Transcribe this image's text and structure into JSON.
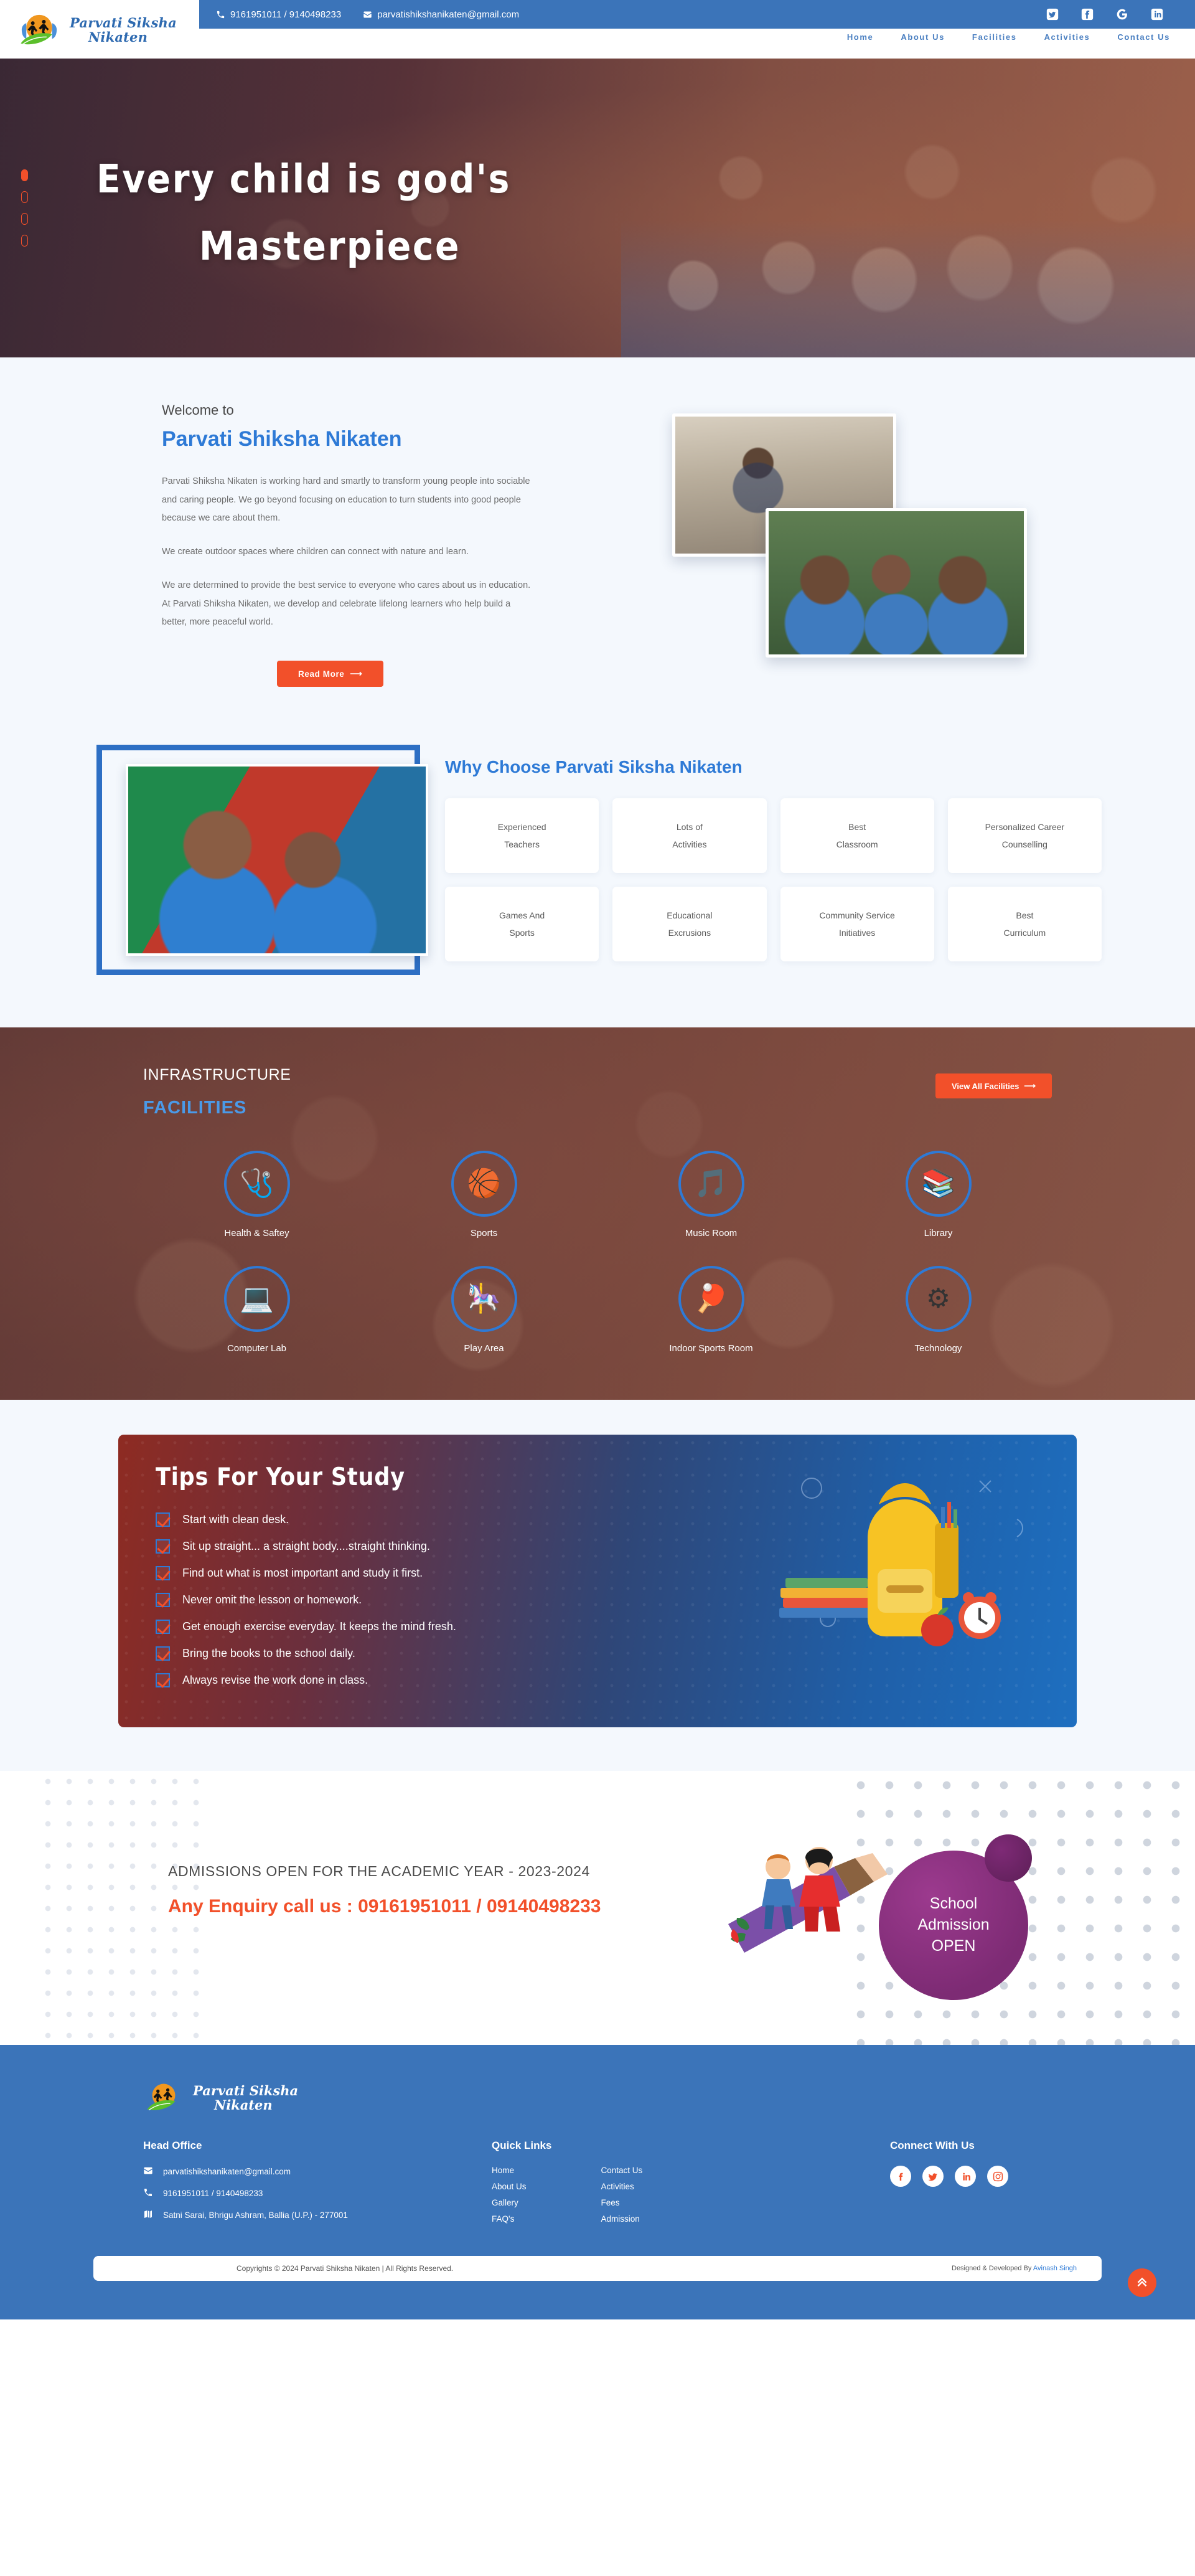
{
  "brand": {
    "name_line1": "Parvati Siksha",
    "name_line2": "Nikaten",
    "logo_icon": "running-children-sun-leaf-logo"
  },
  "topbar": {
    "phone": "9161951011 / 9140498233",
    "phone_icon": "phone-icon",
    "email": "parvatishikshanikaten@gmail.com",
    "email_icon": "envelope-icon",
    "socials": [
      {
        "name": "twitter-icon",
        "label": "Twitter"
      },
      {
        "name": "facebook-icon",
        "label": "Facebook"
      },
      {
        "name": "google-icon",
        "label": "Google"
      },
      {
        "name": "linkedin-icon",
        "label": "LinkedIn"
      }
    ]
  },
  "nav": {
    "items": [
      {
        "label": "Home"
      },
      {
        "label": "About Us"
      },
      {
        "label": "Facilities"
      },
      {
        "label": "Activities"
      },
      {
        "label": "Contact Us"
      }
    ]
  },
  "hero": {
    "title_line1": "Every child is god's",
    "title_line2": "Masterpiece",
    "slide_count": 4,
    "active_slide": 1,
    "dot_color": "#f2502a"
  },
  "welcome": {
    "eyebrow": "Welcome to",
    "title": "Parvati Shiksha Nikaten",
    "paragraphs": [
      "Parvati Shiksha Nikaten is working hard and smartly to transform young people into sociable and caring people. We go beyond focusing on education to turn students into good people because we care about them.",
      "We create outdoor spaces where children can connect with nature and learn.",
      "We are determined to provide the best service to everyone who cares about us in education. At Parvati Shiksha Nikaten, we develop and celebrate lifelong learners who help build a better, more peaceful world."
    ],
    "button_label": "Read More",
    "button_color": "#f2502a",
    "images": [
      {
        "name": "classroom-boy-writing-photo"
      },
      {
        "name": "students-with-books-photo"
      }
    ]
  },
  "why_choose": {
    "title": "Why Choose Parvati Siksha Nikaten",
    "photo": {
      "name": "smiling-students-photo"
    },
    "cards": [
      {
        "line1": "Experienced",
        "line2": "Teachers"
      },
      {
        "line1": "Lots of",
        "line2": "Activities"
      },
      {
        "line1": "Best",
        "line2": "Classroom"
      },
      {
        "line1": "Personalized Career",
        "line2": "Counselling"
      },
      {
        "line1": "Games And",
        "line2": "Sports"
      },
      {
        "line1": "Educational",
        "line2": "Excrusions"
      },
      {
        "line1": "Community Service",
        "line2": "Initiatives"
      },
      {
        "line1": "Best",
        "line2": "Curriculum"
      }
    ]
  },
  "infrastructure": {
    "kicker": "INFRASTRUCTURE",
    "subtitle": "FACILITIES",
    "button_label": "View All Facilities",
    "facilities": [
      {
        "label": "Health & Saftey",
        "icon": "health-safety-icon",
        "glyph": "🩺"
      },
      {
        "label": "Sports",
        "icon": "sports-ball-icon",
        "glyph": "🏀"
      },
      {
        "label": "Music Room",
        "icon": "music-note-icon",
        "glyph": "🎵"
      },
      {
        "label": "Library",
        "icon": "books-icon",
        "glyph": "📚"
      },
      {
        "label": "Computer Lab",
        "icon": "computer-icon",
        "glyph": "💻"
      },
      {
        "label": "Play Area",
        "icon": "playground-icon",
        "glyph": "🎠"
      },
      {
        "label": "Indoor Sports Room",
        "icon": "indoor-sports-icon",
        "glyph": "🏓"
      },
      {
        "label": "Technology",
        "icon": "gear-technology-icon",
        "glyph": "⚙"
      }
    ]
  },
  "tips": {
    "title": "Tips For Your Study",
    "items": [
      "Start with clean desk.",
      "Sit up straight... a straight body....straight thinking.",
      "Find out what is most important and study it first.",
      "Never omit the lesson or homework.",
      "Get enough exercise everyday. It keeps the mind fresh.",
      "Bring the books to the school daily.",
      "Always revise the work done in class."
    ],
    "art": {
      "name": "school-backpack-books-clock-illustration"
    }
  },
  "admission": {
    "line1": "ADMISSIONS OPEN FOR THE ACADEMIC YEAR - 2023-2024",
    "line2": "Any Enquiry call us : 09161951011 / 09140498233",
    "badge_line1": "School",
    "badge_line2": "Admission",
    "badge_line3": "OPEN",
    "badge_color": "#8b2f80",
    "art": {
      "name": "kids-on-pencil-illustration"
    }
  },
  "footer": {
    "office": {
      "heading": "Head Office",
      "email": "parvatishikshanikaten@gmail.com",
      "email_icon": "envelope-icon",
      "phone": "9161951011 / 9140498233",
      "phone_icon": "phone-icon",
      "address": "Satni Sarai, Bhrigu Ashram, Ballia (U.P.) - 277001",
      "address_icon": "map-icon"
    },
    "quick_links": {
      "heading": "Quick Links",
      "column1": [
        "Home",
        "About Us",
        "Gallery",
        "FAQ's"
      ],
      "column2": [
        "Contact Us",
        "Activities",
        "Fees",
        "Admission"
      ]
    },
    "connect": {
      "heading": "Connect With Us",
      "socials": [
        {
          "name": "facebook-icon",
          "label": "Facebook"
        },
        {
          "name": "twitter-icon",
          "label": "Twitter"
        },
        {
          "name": "linkedin-icon",
          "label": "LinkedIn"
        },
        {
          "name": "instagram-icon",
          "label": "Instagram"
        }
      ]
    },
    "copyright": "Copyrights © 2024 Parvati Shiksha Nikaten | All Rights Reserved.",
    "credit_prefix": "Designed & Developed By ",
    "credit_name": "Avinash Singh",
    "scroll_top_icon": "chevron-double-up-icon"
  }
}
